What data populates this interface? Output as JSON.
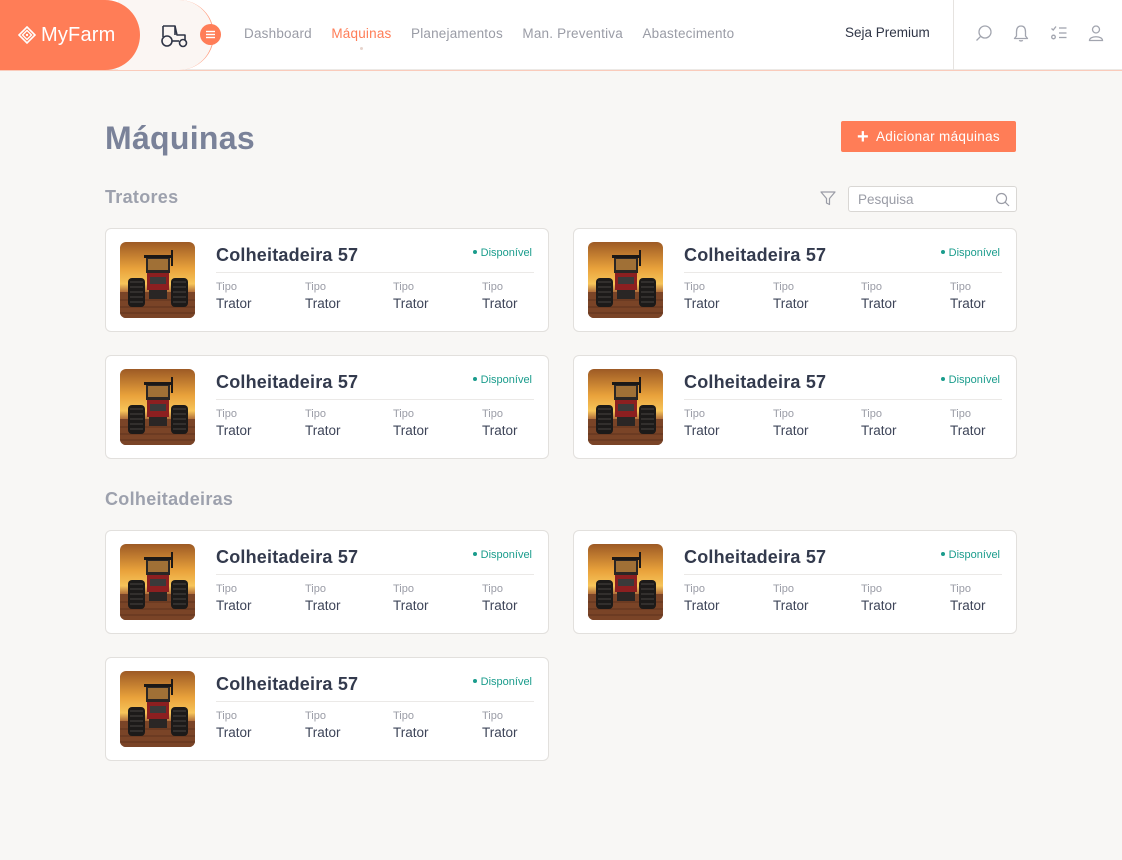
{
  "brand": {
    "name": "MyFarm",
    "accent_color": "#ff7d57"
  },
  "nav": {
    "links": [
      {
        "label": "Dashboard",
        "active": false
      },
      {
        "label": "Máquinas",
        "active": true
      },
      {
        "label": "Planejamentos",
        "active": false
      },
      {
        "label": "Man. Preventiva",
        "active": false
      },
      {
        "label": "Abastecimento",
        "active": false
      }
    ],
    "premium_label": "Seja Premium",
    "icons": [
      "tractor-icon",
      "menu-icon",
      "search-icon",
      "bell-icon",
      "checklist-icon",
      "user-icon"
    ]
  },
  "page": {
    "title": "Máquinas",
    "add_button_label": "Adicionar máquinas",
    "search_placeholder": "Pesquisa"
  },
  "sections": [
    {
      "title": "Tratores",
      "cards": [
        {
          "name": "Colheitadeira 57",
          "status": "Disponível",
          "attrs": [
            {
              "label": "Tipo",
              "value": "Trator"
            },
            {
              "label": "Tipo",
              "value": "Trator"
            },
            {
              "label": "Tipo",
              "value": "Trator"
            },
            {
              "label": "Tipo",
              "value": "Trator"
            }
          ]
        },
        {
          "name": "Colheitadeira 57",
          "status": "Disponível",
          "attrs": [
            {
              "label": "Tipo",
              "value": "Trator"
            },
            {
              "label": "Tipo",
              "value": "Trator"
            },
            {
              "label": "Tipo",
              "value": "Trator"
            },
            {
              "label": "Tipo",
              "value": "Trator"
            }
          ]
        },
        {
          "name": "Colheitadeira 57",
          "status": "Disponível",
          "attrs": [
            {
              "label": "Tipo",
              "value": "Trator"
            },
            {
              "label": "Tipo",
              "value": "Trator"
            },
            {
              "label": "Tipo",
              "value": "Trator"
            },
            {
              "label": "Tipo",
              "value": "Trator"
            }
          ]
        },
        {
          "name": "Colheitadeira 57",
          "status": "Disponível",
          "attrs": [
            {
              "label": "Tipo",
              "value": "Trator"
            },
            {
              "label": "Tipo",
              "value": "Trator"
            },
            {
              "label": "Tipo",
              "value": "Trator"
            },
            {
              "label": "Tipo",
              "value": "Trator"
            }
          ]
        }
      ]
    },
    {
      "title": "Colheitadeiras",
      "cards": [
        {
          "name": "Colheitadeira 57",
          "status": "Disponível",
          "attrs": [
            {
              "label": "Tipo",
              "value": "Trator"
            },
            {
              "label": "Tipo",
              "value": "Trator"
            },
            {
              "label": "Tipo",
              "value": "Trator"
            },
            {
              "label": "Tipo",
              "value": "Trator"
            }
          ]
        },
        {
          "name": "Colheitadeira 57",
          "status": "Disponível",
          "attrs": [
            {
              "label": "Tipo",
              "value": "Trator"
            },
            {
              "label": "Tipo",
              "value": "Trator"
            },
            {
              "label": "Tipo",
              "value": "Trator"
            },
            {
              "label": "Tipo",
              "value": "Trator"
            }
          ]
        },
        {
          "name": "Colheitadeira 57",
          "status": "Disponível",
          "attrs": [
            {
              "label": "Tipo",
              "value": "Trator"
            },
            {
              "label": "Tipo",
              "value": "Trator"
            },
            {
              "label": "Tipo",
              "value": "Trator"
            },
            {
              "label": "Tipo",
              "value": "Trator"
            }
          ]
        }
      ]
    }
  ],
  "colors": {
    "status": "#1a9c8c",
    "background": "#f8f7f5"
  }
}
